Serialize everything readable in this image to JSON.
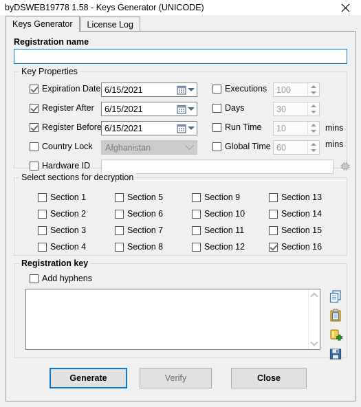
{
  "window": {
    "title": "byDSWEB19778 1.58 - Keys Generator (UNICODE)",
    "close_icon": "close-icon"
  },
  "tabs": [
    {
      "label": "Keys Generator",
      "active": true
    },
    {
      "label": "License Log",
      "active": false
    }
  ],
  "registration_name": {
    "label": "Registration name",
    "value": "",
    "placeholder": ""
  },
  "key_properties": {
    "title": "Key Properties",
    "left_rows": [
      {
        "label": "Expiration Date",
        "checked": true,
        "type": "date",
        "value": "6/15/2021"
      },
      {
        "label": "Register After",
        "checked": true,
        "type": "date",
        "value": "6/15/2021"
      },
      {
        "label": "Register Before",
        "checked": true,
        "type": "date",
        "value": "6/15/2021"
      },
      {
        "label": "Country Lock",
        "checked": false,
        "type": "combo",
        "value": "Afghanistan"
      },
      {
        "label": "Hardware ID",
        "checked": false,
        "type": "text",
        "value": ""
      }
    ],
    "right_rows": [
      {
        "label": "Executions",
        "checked": false,
        "value": "100",
        "unit": ""
      },
      {
        "label": "Days",
        "checked": false,
        "value": "30",
        "unit": ""
      },
      {
        "label": "Run Time",
        "checked": false,
        "value": "10",
        "unit": "mins"
      },
      {
        "label": "Global Time",
        "checked": false,
        "value": "60",
        "unit": "mins"
      }
    ]
  },
  "sections": {
    "title": "Select sections for decryption",
    "items": [
      {
        "label": "Section 1",
        "checked": false
      },
      {
        "label": "Section 2",
        "checked": false
      },
      {
        "label": "Section 3",
        "checked": false
      },
      {
        "label": "Section 4",
        "checked": false
      },
      {
        "label": "Section 5",
        "checked": false
      },
      {
        "label": "Section 6",
        "checked": false
      },
      {
        "label": "Section 7",
        "checked": false
      },
      {
        "label": "Section 8",
        "checked": false
      },
      {
        "label": "Section 9",
        "checked": false
      },
      {
        "label": "Section 10",
        "checked": false
      },
      {
        "label": "Section 11",
        "checked": false
      },
      {
        "label": "Section 12",
        "checked": false
      },
      {
        "label": "Section 13",
        "checked": false
      },
      {
        "label": "Section 14",
        "checked": false
      },
      {
        "label": "Section 15",
        "checked": false
      },
      {
        "label": "Section 16",
        "checked": true
      }
    ]
  },
  "registration_key": {
    "title": "Registration key",
    "add_hyphens": {
      "label": "Add hyphens",
      "checked": false
    },
    "value": "",
    "tools": [
      {
        "name": "copy-icon"
      },
      {
        "name": "paste-icon"
      },
      {
        "name": "add-key-icon"
      },
      {
        "name": "save-icon"
      }
    ]
  },
  "buttons": [
    {
      "label": "Generate",
      "state": "focused"
    },
    {
      "label": "Verify",
      "state": "disabled"
    },
    {
      "label": "Close",
      "state": "normal"
    }
  ],
  "colors": {
    "accent": "#0078d7",
    "window_bg": "#f0f0f0",
    "field_bg": "#ffffff",
    "border": "#9a9a9a"
  }
}
